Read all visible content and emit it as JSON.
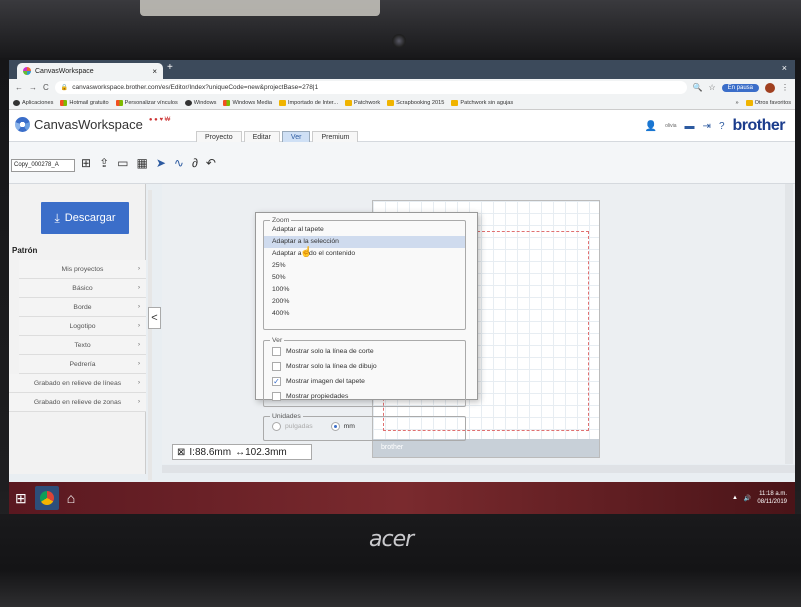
{
  "browser": {
    "tab_title": "CanvasWorkspace",
    "tab_close": "×",
    "new_tab": "+",
    "window_close": "×",
    "url": "canvasworkspace.brother.com/es/Editor/Index?uniqueCode=new&projectBase=278|1",
    "profile_status": "En pausa",
    "bookmarks": [
      "Aplicaciones",
      "Hotmail gratuito",
      "Personalizar vínculos",
      "Windows",
      "Windows Media",
      "Importado de Inter...",
      "Patchwork",
      "Scrapbooking 2015",
      "Patchwork sin agujas"
    ],
    "bookmarks_more": "»",
    "other_bookmarks": "Otros favoritos"
  },
  "app": {
    "logo_text": "CanvasWorkspace",
    "menu_tabs": [
      "Proyecto",
      "Editar",
      "Ver",
      "Premium"
    ],
    "active_tab": "Ver",
    "user_name": "olivia",
    "brand": "brother",
    "project_name": "Copy_000278_A"
  },
  "sidebar": {
    "download_label": "Descargar",
    "section_title": "Patrón",
    "categories": [
      "Mis proyectos",
      "Básico",
      "Borde",
      "Logotipo",
      "Texto",
      "Pedrería",
      "Grabado en relieve de líneas",
      "Grabado en relieve de zonas"
    ],
    "collapse_label": "<"
  },
  "canvas": {
    "dims_height": "I:88.6mm",
    "dims_width": "↔102.3mm",
    "mat_brand": "brother"
  },
  "ver_menu": {
    "zoom_legend": "Zoom",
    "zoom_items": [
      "Adaptar al tapete",
      "Adaptar a la selección",
      "Adaptar a todo el contenido",
      "25%",
      "50%",
      "100%",
      "200%",
      "400%"
    ],
    "highlighted_zoom": "Adaptar a la selección",
    "ver_legend": "Ver",
    "options": [
      {
        "label": "Mostrar solo la línea de corte",
        "checked": false
      },
      {
        "label": "Mostrar solo la línea de dibujo",
        "checked": false
      },
      {
        "label": "Mostrar imagen del tapete",
        "checked": true
      },
      {
        "label": "Mostrar propiedades",
        "checked": false
      }
    ],
    "units_legend": "Unidades",
    "unit_inches": "pulgadas",
    "unit_mm": "mm",
    "selected_unit": "mm"
  },
  "taskbar": {
    "time": "11:18 a.m.",
    "date": "08/11/2019"
  },
  "laptop": {
    "brand": "acer"
  },
  "colors": {
    "accent": "#3b6ec9",
    "brother_blue": "#1b3c8c",
    "taskbar": "#6a2228"
  }
}
